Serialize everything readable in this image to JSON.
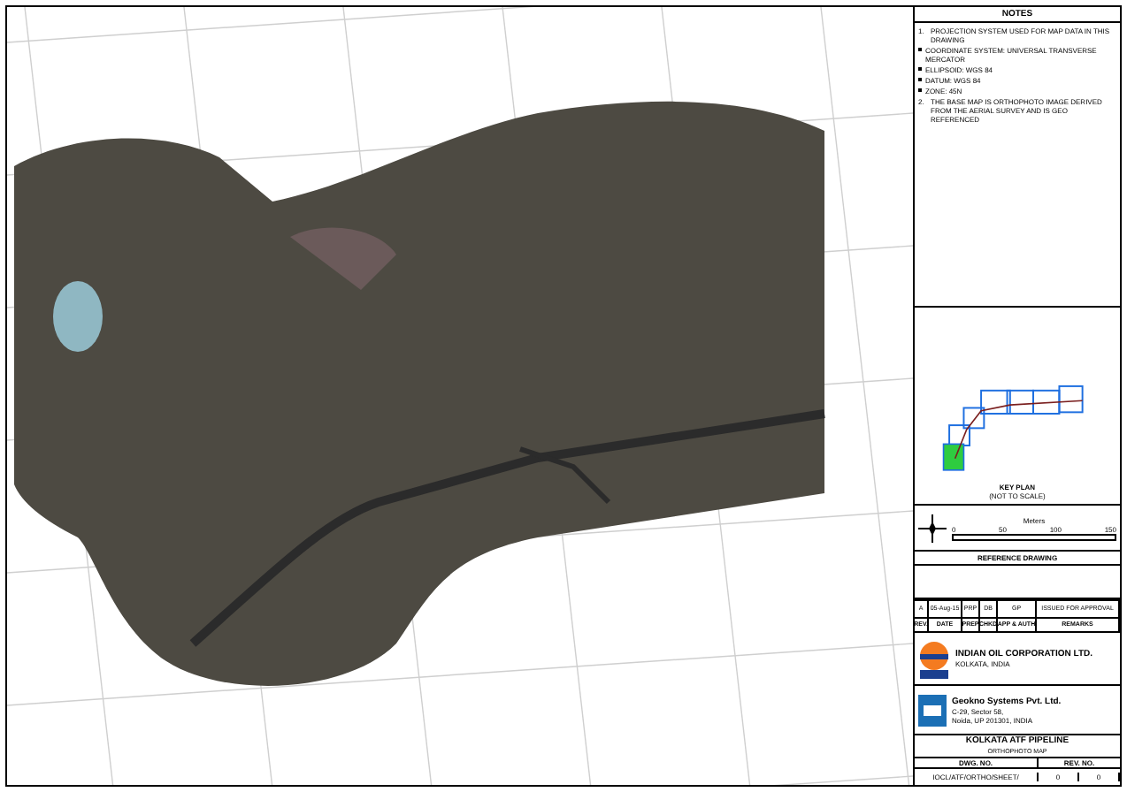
{
  "notes": {
    "title": "NOTES",
    "items": [
      {
        "marker": "1.",
        "text": "PROJECTION SYSTEM USED FOR MAP DATA IN THIS DRAWING"
      },
      {
        "marker": "",
        "text": "COORDINATE SYSTEM: UNIVERSAL TRANSVERSE MERCATOR"
      },
      {
        "marker": "",
        "text": "ELLIPSOID: WGS 84"
      },
      {
        "marker": "",
        "text": "DATUM: WGS 84"
      },
      {
        "marker": "",
        "text": "ZONE: 45N"
      },
      {
        "marker": "2.",
        "text": "THE BASE MAP IS ORTHOPHOTO IMAGE DERIVED FROM THE AERIAL SURVEY AND IS GEO REFERENCED"
      }
    ]
  },
  "key_plan": {
    "title": "KEY PLAN",
    "subtitle": "(NOT TO SCALE)"
  },
  "scale_bar": {
    "unit": "Meters",
    "ticks": [
      "0",
      "50",
      "100",
      "150"
    ]
  },
  "reference": {
    "title": "REFERENCE DRAWING"
  },
  "revisions": {
    "entries": [
      [
        "A",
        "05-Aug-15",
        "PRP",
        "DB",
        "GP",
        "ISSUED FOR APPROVAL"
      ]
    ],
    "footer_labels": [
      "REV.",
      "DATE",
      "PREP",
      "CHKD",
      "APP & AUTH",
      "REMARKS"
    ]
  },
  "client": {
    "name": "INDIAN OIL CORPORATION LTD.",
    "location": "KOLKATA, INDIA"
  },
  "consultant": {
    "name": "Geokno Systems Pvt. Ltd.",
    "address_1": "C-29, Sector 58,",
    "address_2": "Noida, UP 201301, INDIA"
  },
  "drawing_title": "KOLKATA ATF PIPELINE",
  "drawing_subtitle": "ORTHOPHOTO MAP",
  "drawing_no": {
    "label": "DWG. NO.",
    "value": "IOCL/ATF/ORTHO/SHEET/"
  },
  "sheet": {
    "label": "REV. NO.",
    "values": [
      "0",
      "0"
    ]
  }
}
